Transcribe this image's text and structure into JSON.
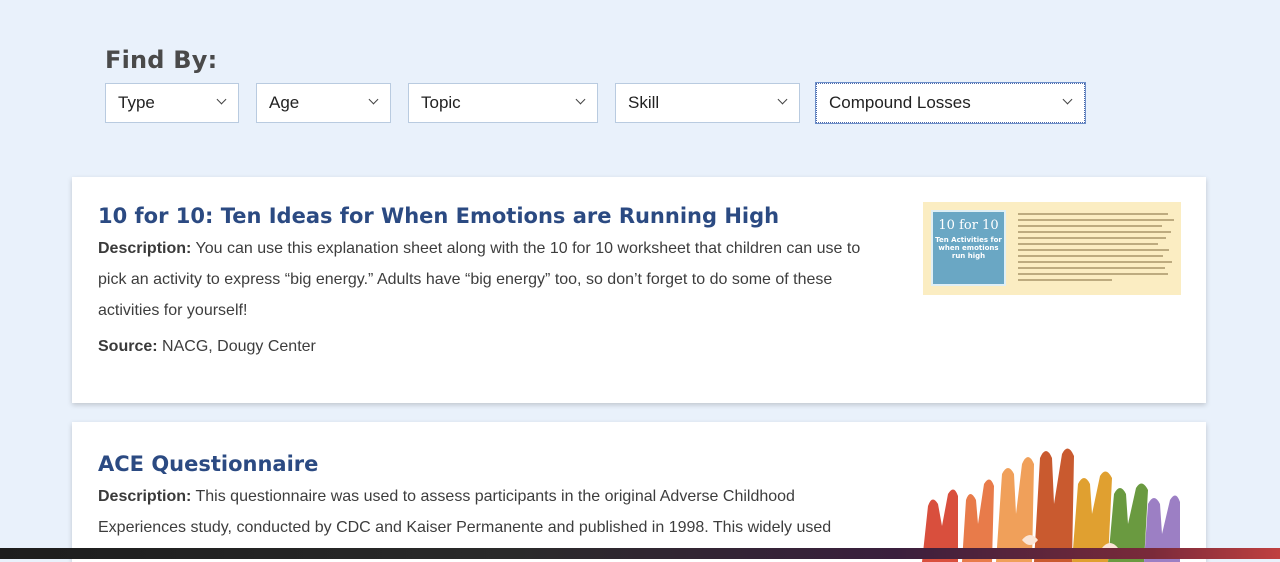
{
  "filters": {
    "heading": "Find By:",
    "selects": [
      {
        "value": "Type"
      },
      {
        "value": "Age"
      },
      {
        "value": "Topic"
      },
      {
        "value": "Skill"
      },
      {
        "value": "Compound Losses"
      }
    ]
  },
  "resources": [
    {
      "title": "10 for 10: Ten Ideas for When Emotions are Running High",
      "description_label": "Description:",
      "description": "You can use this explanation sheet along with the 10 for 10 worksheet that children can use to pick an activity to express “big energy.” Adults have “big energy” too, so don’t forget to do some of these activities for yourself!",
      "source_label": "Source:",
      "source": "NACG, Dougy Center",
      "thumbnail": {
        "heading": "10 for 10",
        "subheading": "Ten Activities for when emotions run high"
      }
    },
    {
      "title": "ACE Questionnaire",
      "description_label": "Description:",
      "description": "This questionnaire was used to assess participants in the original Adverse Childhood Experiences study, conducted by CDC and Kaiser Permanente and published in 1998. This widely used"
    }
  ]
}
